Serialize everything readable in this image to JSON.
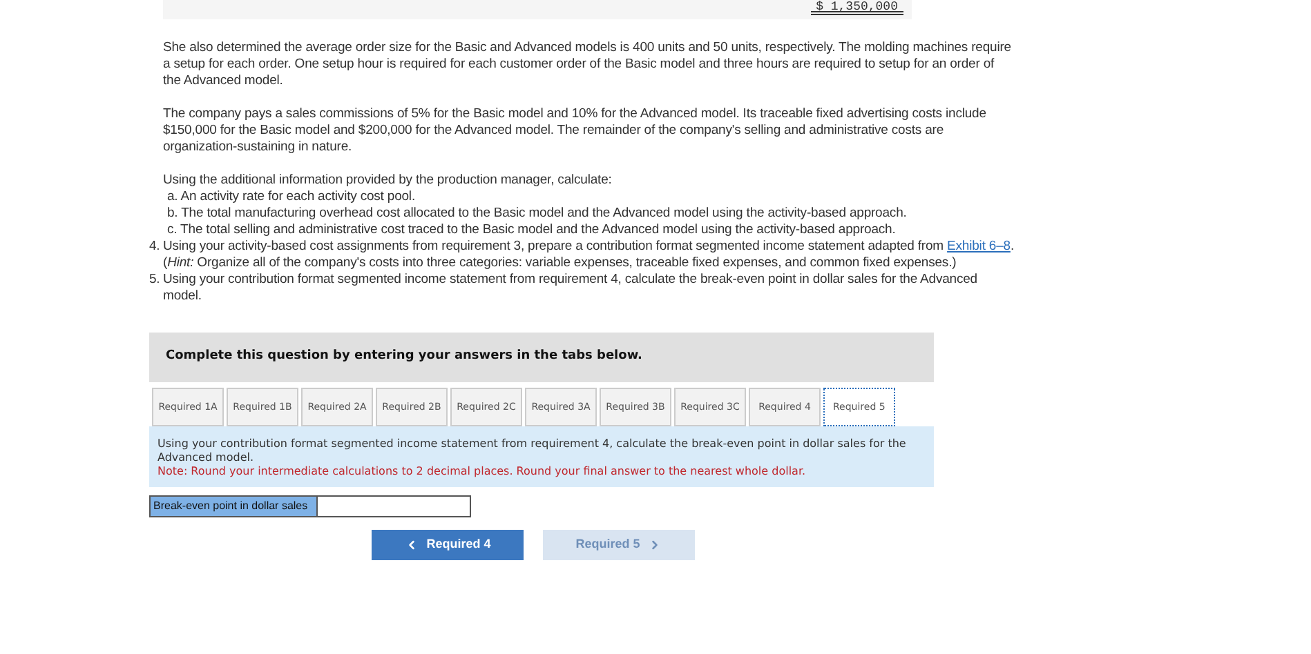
{
  "top_table": {
    "total": "$ 1,350,000"
  },
  "paragraphs": [
    "She also determined the average order size for the Basic and Advanced models is 400 units and 50 units, respectively. The molding machines require a setup for each order. One setup hour is required for each customer order of the Basic model and three hours are required to setup for an order of the Advanced model.",
    "The company pays a sales commissions of 5% for the Basic model and 10% for the Advanced model. Its traceable fixed advertising costs include $150,000 for the Basic model and $200,000 for the Advanced model. The remainder of the company's selling and administrative costs are organization-sustaining in nature."
  ],
  "requirements": [
    {
      "text": "Using the additional information provided by the production manager, calculate:",
      "subitems": [
        "a. An activity rate for each activity cost pool.",
        "b. The total manufacturing overhead cost allocated to the Basic model and the Advanced model using the activity-based approach.",
        "c. The total selling and administrative cost traced to the Basic model and the Advanced model using the activity-based approach."
      ]
    },
    {
      "number": "4.",
      "text": "Using your activity-based cost assignments from requirement 3, prepare a contribution format segmented income statement adapted from",
      "link": "Exhibit 6–8",
      "text_after": ". (*Hint:* Organize all of the company's costs into three categories: variable expenses, traceable fixed expenses, and common fixed expenses.)"
    },
    {
      "number": "5.",
      "text": "Using your contribution format segmented income statement from requirement 4, calculate the break-even point in dollar sales for the Advanced model."
    }
  ],
  "question_header": "Complete this question by entering your answers in the tabs below.",
  "tabs": [
    {
      "label": "Required 1A",
      "selected": false
    },
    {
      "label": "Required 1B",
      "selected": false
    },
    {
      "label": "Required 2A",
      "selected": false
    },
    {
      "label": "Required 2B",
      "selected": false
    },
    {
      "label": "Required 2C",
      "selected": false
    },
    {
      "label": "Required 3A",
      "selected": false
    },
    {
      "label": "Required 3B",
      "selected": false
    },
    {
      "label": "Required 3C",
      "selected": false
    },
    {
      "label": "Required 4",
      "selected": false
    },
    {
      "label": "Required 5",
      "selected": true
    }
  ],
  "instructions": {
    "text": "Using your contribution format segmented income statement from requirement 4, calculate the break-even point in dollar sales for the Advanced model.",
    "note": "Note: Round your intermediate calculations to 2 decimal places. Round your final answer to the nearest whole dollar."
  },
  "answer_row": {
    "label": "Break-even point in dollar sales"
  },
  "nav_buttons": [
    {
      "label": "Required 4",
      "kind": "prev",
      "disabled": false
    },
    {
      "label": "Required 5",
      "kind": "next",
      "disabled": true
    }
  ]
}
